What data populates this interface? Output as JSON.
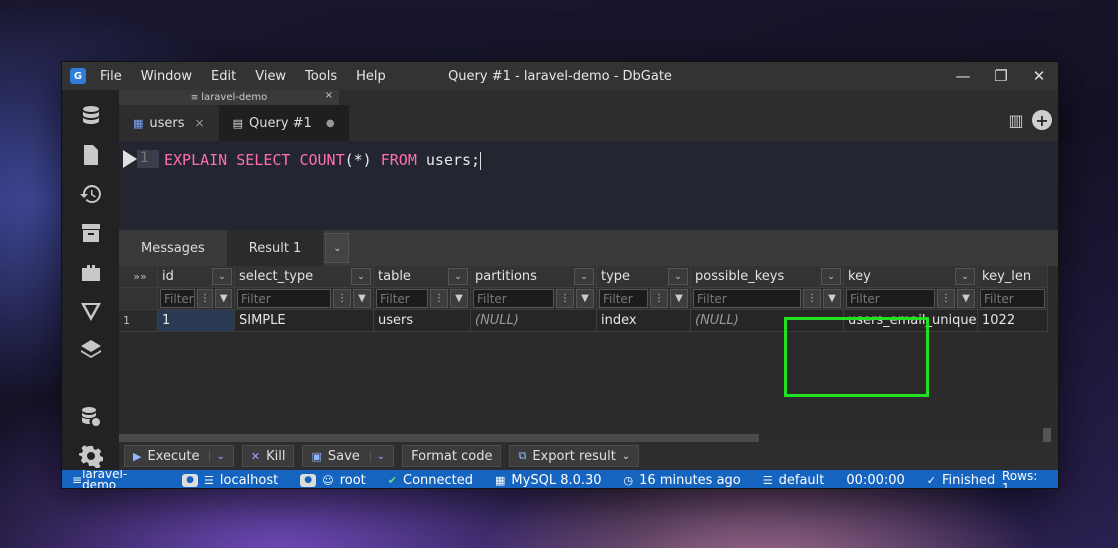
{
  "app": {
    "title": "Query #1 - laravel-demo - DbGate",
    "menu": [
      "File",
      "Window",
      "Edit",
      "View",
      "Tools",
      "Help"
    ],
    "icon_letter": "G"
  },
  "connection_tab": {
    "label": "laravel-demo",
    "close": "×"
  },
  "tabs": [
    {
      "label": "users",
      "icon": "table-icon",
      "close": "×"
    },
    {
      "label": "Query #1",
      "icon": "file-icon",
      "close": "●"
    }
  ],
  "editor": {
    "line_number": "1",
    "code_keyword_1": "EXPLAIN SELECT COUNT",
    "code_plain_1": "(*)",
    "code_keyword_2": " FROM ",
    "code_plain_2": "users;"
  },
  "result_tabs": [
    {
      "label": "Messages"
    },
    {
      "label": "Result 1"
    }
  ],
  "grid": {
    "row_header_symbol": "»»",
    "filter_placeholder": "Filter",
    "columns": [
      "id",
      "select_type",
      "table",
      "partitions",
      "type",
      "possible_keys",
      "key",
      "key_len"
    ],
    "rows": [
      {
        "num": "1",
        "values": [
          "1",
          "SIMPLE",
          "users",
          "(NULL)",
          "index",
          "(NULL)",
          "users_email_unique",
          "1022"
        ]
      }
    ]
  },
  "toolbar": {
    "execute": "Execute",
    "kill": "Kill",
    "save": "Save",
    "format": "Format code",
    "export": "Export result"
  },
  "status": {
    "database": "laravel-demo",
    "server": "localhost",
    "user": "root",
    "connection": "Connected",
    "engine": "MySQL 8.0.30",
    "time_ago": "16 minutes ago",
    "schema": "default",
    "duration": "00:00:00",
    "state": "Finished",
    "rows": "Rows: 1"
  },
  "colors": {
    "accent": "#1565c0",
    "keyword": "#ff6fb0",
    "highlight": "#22e022"
  }
}
